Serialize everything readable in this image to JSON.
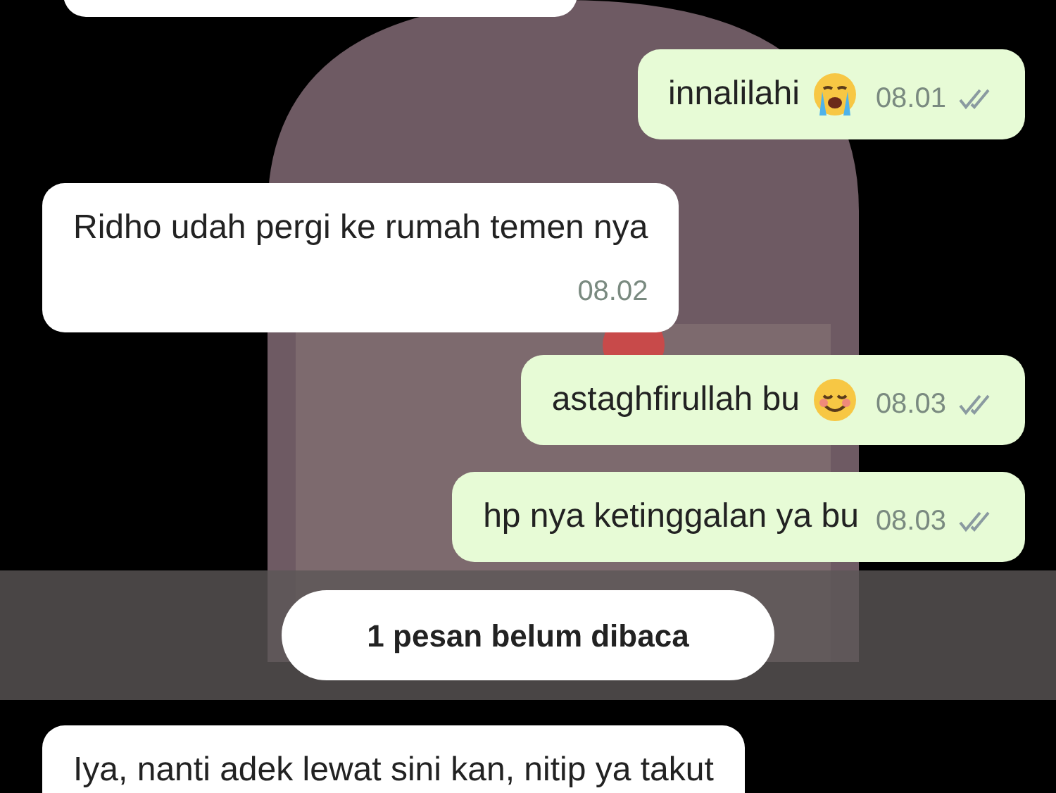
{
  "messages": [
    {
      "kind": "cut"
    },
    {
      "kind": "outgoing",
      "parts": [
        {
          "kind": "text",
          "text": "innalilahi"
        },
        {
          "kind": "crying"
        }
      ],
      "time": "08.01",
      "delivered": true
    },
    {
      "kind": "incoming",
      "parts": [
        {
          "kind": "text",
          "text": "Ridho udah pergi ke rumah temen nya"
        }
      ],
      "time": "08.02"
    },
    {
      "kind": "outgoing",
      "parts": [
        {
          "kind": "text",
          "text": "astaghfirullah bu"
        },
        {
          "kind": "smiling"
        }
      ],
      "time": "08.03",
      "delivered": true
    },
    {
      "kind": "outgoing",
      "parts": [
        {
          "kind": "text",
          "text": "hp nya ketinggalan ya bu"
        }
      ],
      "time": "08.03",
      "delivered": true
    },
    {
      "kind": "unread",
      "text": "1 pesan belum dibaca"
    },
    {
      "kind": "incoming",
      "parts": [
        {
          "kind": "text",
          "text": "Iya, nanti adek lewat sini kan, nitip ya takut"
        }
      ]
    }
  ]
}
